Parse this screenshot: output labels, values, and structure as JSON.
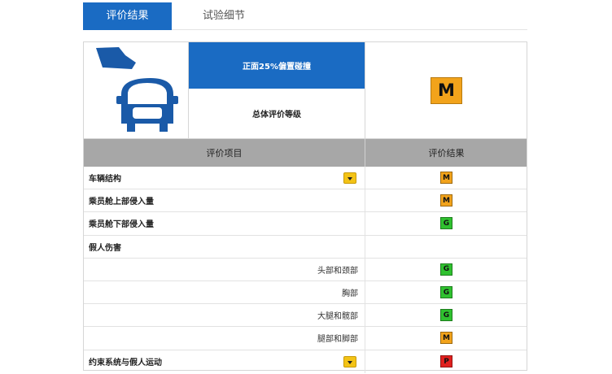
{
  "tabs": [
    {
      "label": "评价结果",
      "active": true
    },
    {
      "label": "试验细节",
      "active": false
    }
  ],
  "summary": {
    "test_name": "正面25%偏置碰撞",
    "overall_label": "总体评价等级",
    "overall_rating": "M",
    "overall_color": "#f2a31b"
  },
  "table": {
    "headers": [
      "评价项目",
      "评价结果"
    ],
    "rows": [
      {
        "label": "车辆结构",
        "bold": true,
        "expandable": true,
        "rating": "M"
      },
      {
        "label": "乘员舱上部侵入量",
        "bold": true,
        "expandable": false,
        "rating": "M"
      },
      {
        "label": "乘员舱下部侵入量",
        "bold": true,
        "expandable": false,
        "rating": "G"
      },
      {
        "label": "假人伤害",
        "bold": true,
        "expandable": false,
        "rating": ""
      },
      {
        "label": "头部和颈部",
        "bold": false,
        "expandable": false,
        "rating": "G"
      },
      {
        "label": "胸部",
        "bold": false,
        "expandable": false,
        "rating": "G"
      },
      {
        "label": "大腿和髋部",
        "bold": false,
        "expandable": false,
        "rating": "G"
      },
      {
        "label": "腿部和脚部",
        "bold": false,
        "expandable": false,
        "rating": "M"
      },
      {
        "label": "约束系统与假人运动",
        "bold": true,
        "expandable": true,
        "rating": "P"
      }
    ]
  },
  "colors": {
    "accent_blue": "#1a6bc3",
    "rating_G": "#2fc12f",
    "rating_M": "#f2a31b",
    "rating_P": "#e0201e",
    "header_gray": "#a7a7a7"
  },
  "icons": {
    "car_illustration": "car-front-offset-barrier-icon",
    "expand": "chevron-down-icon"
  }
}
